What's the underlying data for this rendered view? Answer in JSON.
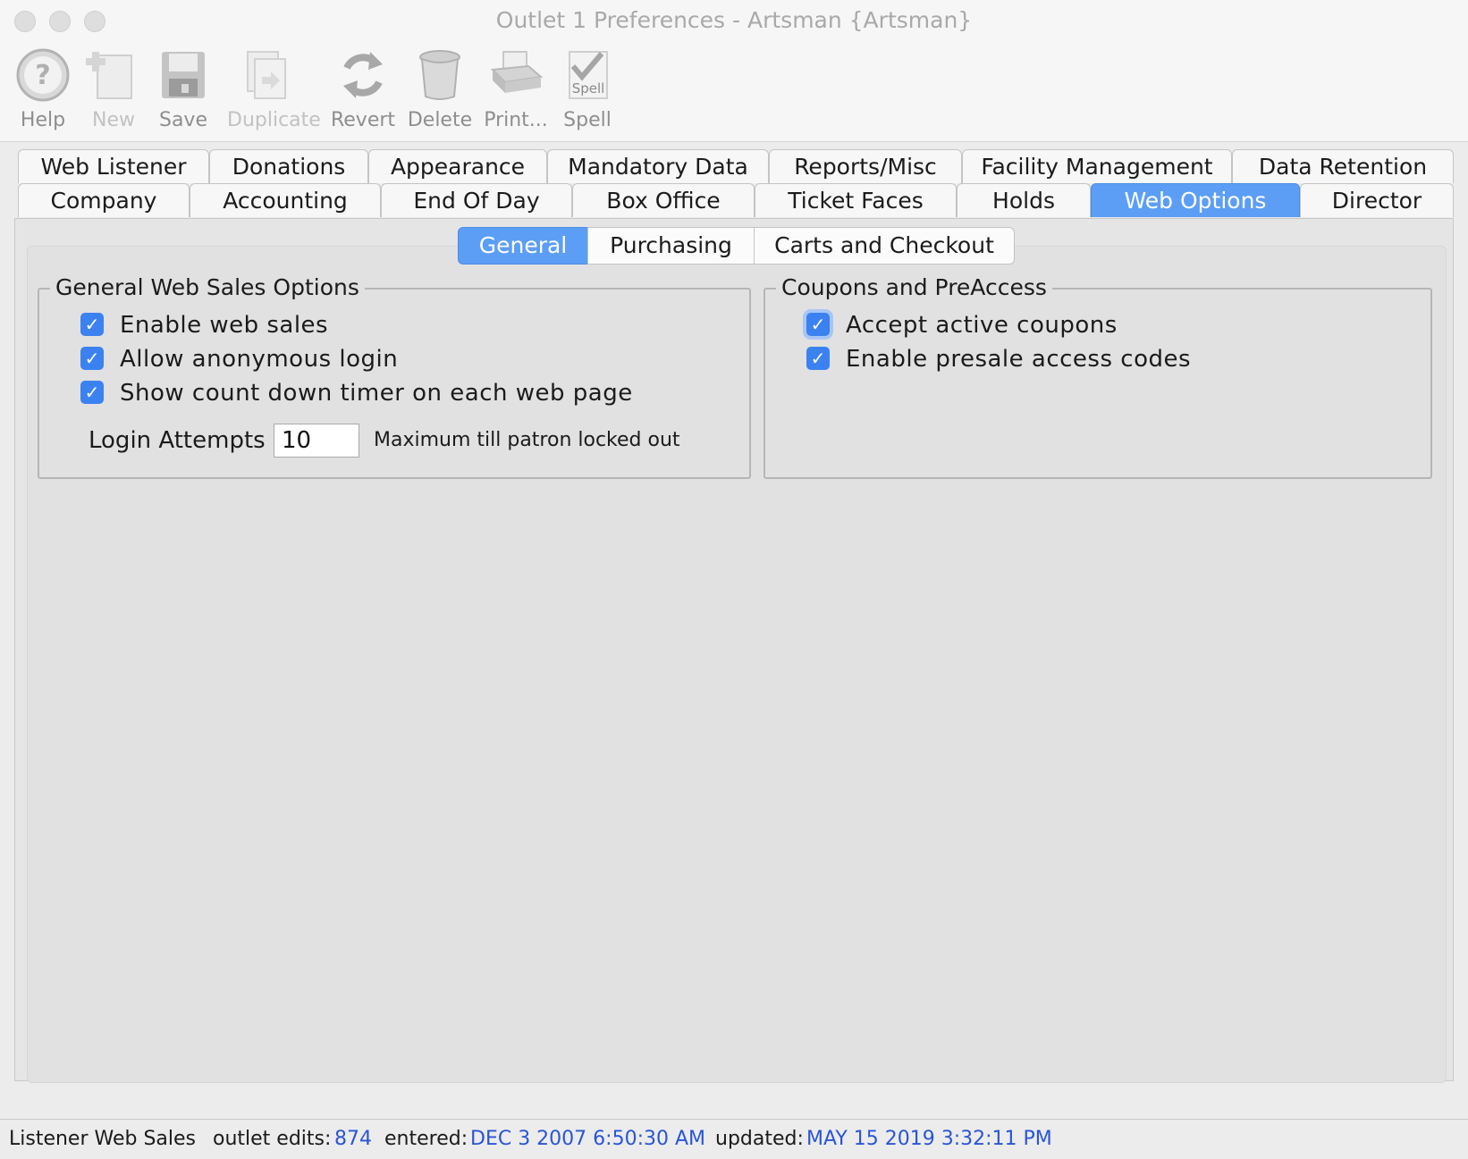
{
  "window": {
    "title": "Outlet 1 Preferences - Artsman {Artsman}"
  },
  "toolbar": {
    "help": "Help",
    "new": "New",
    "save": "Save",
    "duplicate": "Duplicate",
    "revert": "Revert",
    "delete": "Delete",
    "print": "Print...",
    "spell": "Spell",
    "spell_icon_text": "Spell"
  },
  "tabs_row1": [
    "Web Listener",
    "Donations",
    "Appearance",
    "Mandatory Data",
    "Reports/Misc",
    "Facility Management",
    "Data Retention"
  ],
  "tabs_row2": [
    "Company",
    "Accounting",
    "End Of Day",
    "Box Office",
    "Ticket Faces",
    "Holds",
    "Web Options",
    "Director"
  ],
  "active_tab": "Web Options",
  "subtabs": [
    "General",
    "Purchasing",
    "Carts and Checkout"
  ],
  "active_subtab": "General",
  "general_group": {
    "title": "General Web Sales Options",
    "options": [
      {
        "label": "Enable web sales",
        "checked": true
      },
      {
        "label": "Allow anonymous login",
        "checked": true
      },
      {
        "label": "Show count down timer on each web page",
        "checked": true
      }
    ],
    "login_attempts_label": "Login Attempts",
    "login_attempts_value": "10",
    "login_attempts_hint": "Maximum till patron locked out"
  },
  "coupons_group": {
    "title": "Coupons and PreAccess",
    "options": [
      {
        "label": "Accept active coupons",
        "checked": true
      },
      {
        "label": "Enable presale access codes",
        "checked": true
      }
    ]
  },
  "status": {
    "left": "Listener Web Sales",
    "outlet_edits_label": "outlet edits:",
    "outlet_edits_value": "874",
    "entered_label": "entered:",
    "entered_value": "DEC 3 2007 6:50:30 AM",
    "updated_label": "updated:",
    "updated_value": "MAY 15 2019 3:32:11 PM"
  },
  "colors": {
    "accent": "#5c9ef5",
    "checkbox": "#3b82f0",
    "status_value": "#2a55d6"
  }
}
